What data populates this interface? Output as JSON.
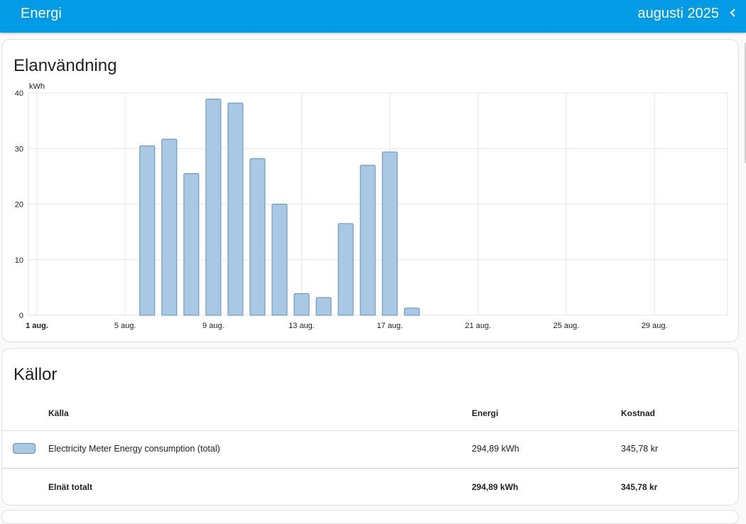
{
  "header": {
    "title": "Energi",
    "period": "augusti 2025",
    "back_icon": "chevron-left-icon"
  },
  "consumption_card": {
    "title": "Elanvändning",
    "unit": "kWh"
  },
  "chart_data": {
    "type": "bar",
    "ylabel": "kWh",
    "ylim": [
      0,
      40
    ],
    "yticks": [
      "0",
      "10",
      "20",
      "30",
      "40"
    ],
    "xlim": [
      1,
      32.7
    ],
    "xticks": [
      {
        "day": 1,
        "label": "1 aug.",
        "bold": true
      },
      {
        "day": 5,
        "label": "5 aug.",
        "bold": false
      },
      {
        "day": 9,
        "label": "9 aug.",
        "bold": false
      },
      {
        "day": 13,
        "label": "13 aug.",
        "bold": false
      },
      {
        "day": 17,
        "label": "17 aug.",
        "bold": false
      },
      {
        "day": 21,
        "label": "21 aug.",
        "bold": false
      },
      {
        "day": 25,
        "label": "25 aug.",
        "bold": false
      },
      {
        "day": 29,
        "label": "29 aug.",
        "bold": false
      }
    ],
    "grid": true,
    "series": [
      {
        "color": "#a8c8e4",
        "stroke": "#5b91c0",
        "points": [
          {
            "day": 6,
            "value": 30.5
          },
          {
            "day": 7,
            "value": 31.7
          },
          {
            "day": 8,
            "value": 25.5
          },
          {
            "day": 9,
            "value": 38.9
          },
          {
            "day": 10,
            "value": 38.2
          },
          {
            "day": 11,
            "value": 28.2
          },
          {
            "day": 12,
            "value": 20.0
          },
          {
            "day": 13,
            "value": 3.9
          },
          {
            "day": 14,
            "value": 3.2
          },
          {
            "day": 15,
            "value": 16.5
          },
          {
            "day": 16,
            "value": 27.0
          },
          {
            "day": 17,
            "value": 29.4
          },
          {
            "day": 18,
            "value": 1.3
          }
        ]
      }
    ]
  },
  "sources_card": {
    "title": "Källor",
    "columns": {
      "source": "Källa",
      "energy": "Energi",
      "cost": "Kostnad"
    },
    "rows": [
      {
        "source": "Electricity Meter Energy consumption (total)",
        "energy": "294,89 kWh",
        "cost": "345,78 kr",
        "color": "#a8c8e4"
      }
    ],
    "total": {
      "label": "Elnät totalt",
      "energy": "294,89 kWh",
      "cost": "345,78 kr"
    }
  }
}
